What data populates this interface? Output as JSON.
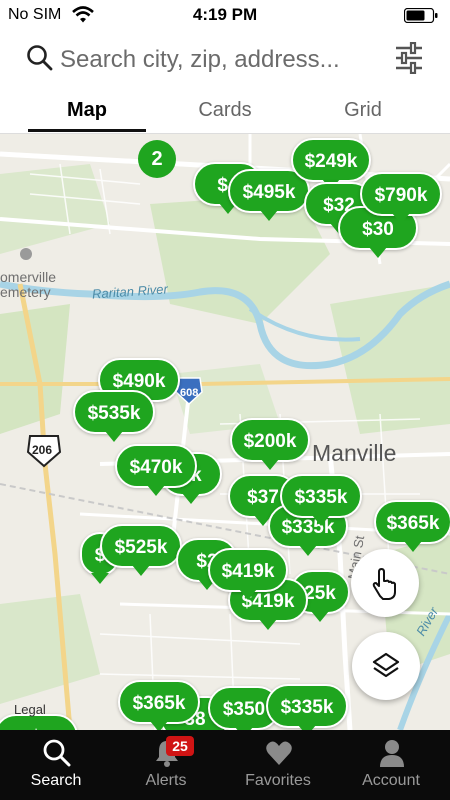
{
  "status_bar": {
    "carrier": "No SIM",
    "time": "4:19 PM"
  },
  "search": {
    "placeholder": "Search city, zip, address..."
  },
  "tabs": [
    {
      "label": "Map",
      "active": true
    },
    {
      "label": "Cards",
      "active": false
    },
    {
      "label": "Grid",
      "active": false
    }
  ],
  "map": {
    "labels": {
      "cemetery": "omerville\nemetery",
      "river": "Raritan River",
      "town": "Manville",
      "street": "Main St",
      "river_right": "River",
      "route_608": "608",
      "route_206": "206",
      "legal": "Legal"
    },
    "cluster_count": "2",
    "pins": [
      "$4",
      "$495k",
      "$249k",
      "$32",
      "$790k",
      "$30",
      "$490k",
      "$535k",
      "$200k",
      "$470k",
      "0k",
      "$37",
      "$335k",
      "$365k",
      "$525k",
      "$",
      "$2",
      "$419k",
      "$419k",
      "25k",
      "$365k",
      "$350",
      "$335k",
      "38"
    ]
  },
  "nav": {
    "items": [
      {
        "label": "Search",
        "icon": "search-icon",
        "active": true
      },
      {
        "label": "Alerts",
        "icon": "bell-icon",
        "active": false,
        "badge": "25"
      },
      {
        "label": "Favorites",
        "icon": "heart-icon",
        "active": false
      },
      {
        "label": "Account",
        "icon": "person-icon",
        "active": false
      }
    ]
  },
  "colors": {
    "pin_green": "#1fa51f",
    "map_background": "#efede6",
    "nav_background": "#0b0b0b",
    "badge_red": "#d01414"
  }
}
